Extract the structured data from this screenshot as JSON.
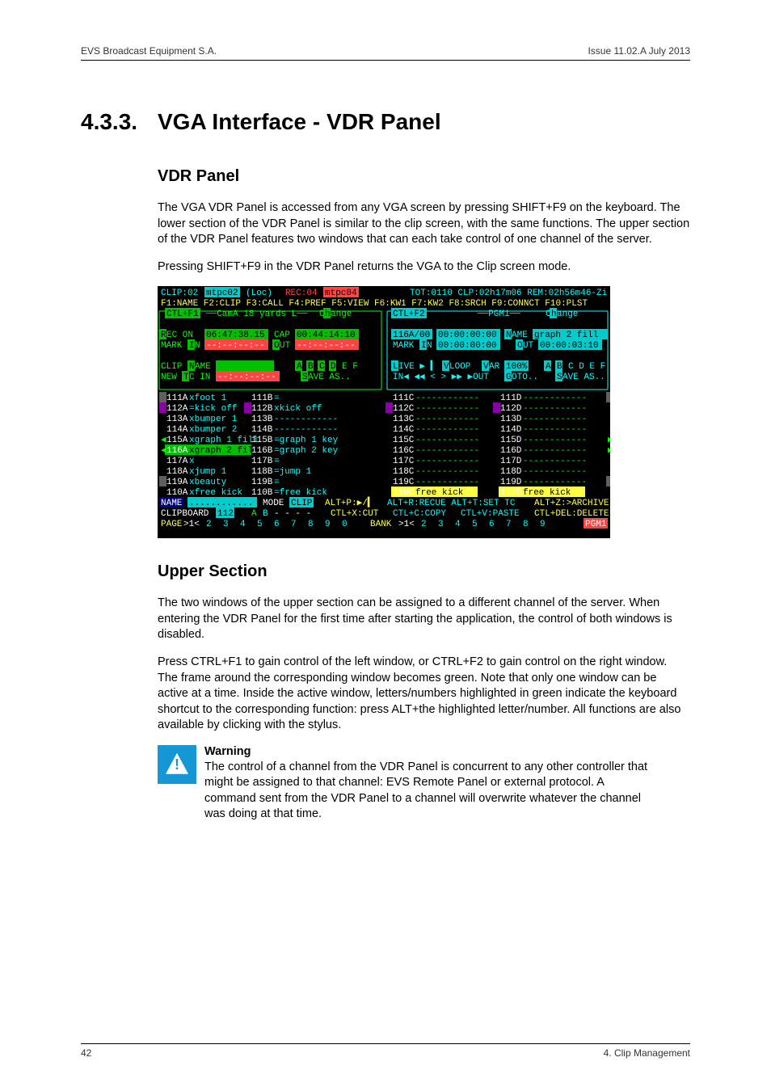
{
  "header": {
    "left": "EVS Broadcast Equipment S.A.",
    "right": "Issue 11.02.A  July 2013"
  },
  "section": {
    "number": "4.3.3.",
    "title": "VGA Interface - VDR Panel"
  },
  "vdr": {
    "heading": "VDR Panel",
    "p1_a": "The VGA VDR Panel is accessed from any VGA screen by pressing ",
    "p1_b": "SHIFT+F9",
    "p1_c": " on the keyboard. The lower section of the VDR Panel is similar to the clip screen, with the same functions. The upper section of the VDR Panel features two windows that can each take control of one channel of the server.",
    "p2_a": "Pressing ",
    "p2_b": "SHIFT+F9",
    "p2_c": " in the VDR Panel returns the VGA to the Clip screen mode."
  },
  "upper": {
    "heading": "Upper Section",
    "p1": "The two windows of the upper section can be assigned to a different channel of the server. When entering the VDR Panel for the first time after starting the application, the control of both windows is disabled.",
    "p2_a": "Press ",
    "p2_b": "CTRL+F1",
    "p2_c": " to gain control of the left window, or ",
    "p2_d": "CTRL+F2",
    "p2_e": " to gain control on the right window. The frame around the corresponding window becomes green. Note that only one window can be active at a time. Inside the active window, letters/numbers highlighted in green indicate the keyboard shortcut to the corresponding function: press ",
    "p2_f": "ALT+",
    "p2_g": "the highlighted letter/number. All functions are also available by clicking with the stylus."
  },
  "warn": {
    "title": "Warning",
    "body": "The control of a channel from the VDR Panel is concurrent to any other controller that might be assigned to that channel: EVS Remote Panel or external protocol. A command sent from the VDR Panel to a channel will overwrite whatever the channel was doing at that time."
  },
  "footer": {
    "left": "42",
    "right": "4. Clip Management"
  },
  "chart_data": {
    "type": "table",
    "title": "VGA VDR Panel screenshot (text-mode terminal UI)",
    "header_line": "CLIP:02 mtpc02  (Loc) REC:04 mtpc04        TOT:0110 CLP:02h17m06 REM:02h56m46-Zi",
    "fkeys": "F1:NAME F2:CLIP F3:CALL F4:PREF F5:VIEW F6:KW1 F7:KW2 F8:SRCH F9:CONNCT F10:PLST",
    "left_window": {
      "frame": "CTL+F1",
      "title": "CamA 18 yards L",
      "change": "Change",
      "rec": {
        "label": "REC ON",
        "tc": "06:47:38.15",
        "cap": "CAP",
        "cap_tc": "00:44:14:10"
      },
      "mark": {
        "in_label": "MARK IN",
        "in_tc": "--:--:--:--",
        "out_label": "OUT",
        "out_tc": "--:--:--:--"
      },
      "clip_name": {
        "label": "CLIP NAME",
        "value": "",
        "cams": "A B C D E F"
      },
      "new_tc": {
        "label": "NEW TC IN",
        "value": "--:--:--:--",
        "save": "SAVE AS.."
      }
    },
    "right_window": {
      "frame": "CTL+F2",
      "title": "PGM1",
      "change": "Change",
      "rec": {
        "id": "116A/00",
        "tc": "00:00:00:00",
        "name_label": "NAME",
        "name": "graph 2 fill"
      },
      "mark": {
        "in_label": "MARK IN",
        "in_tc": "00:00:00:00",
        "out_label": "OUT",
        "out_tc": "00:00:03:10"
      },
      "live": {
        "label": "LIVE ▶ ▍ VLOOP",
        "var": "VAR 100%",
        "cams": "A B C D E F"
      },
      "transport": {
        "label": "IN◀ ◀◀ <  > ▶▶ ▶OUT GOTO..",
        "save": "SAVE AS.."
      }
    },
    "clip_grid": {
      "columns": [
        "A",
        "B",
        "C",
        "D"
      ],
      "rows": [
        {
          "A": {
            "id": "111A",
            "name": "xfoot 1"
          },
          "B": {
            "id": "111B",
            "name": "="
          },
          "C": {
            "id": "111C",
            "name": "------------"
          },
          "D": {
            "id": "111D",
            "name": "------------"
          }
        },
        {
          "A": {
            "id": "112A",
            "name": "=kick off",
            "aux": true
          },
          "B": {
            "id": "112B",
            "name": "xkick off",
            "aux": true
          },
          "C": {
            "id": "112C",
            "name": "------------",
            "aux": true
          },
          "D": {
            "id": "112D",
            "name": "------------",
            "aux": true
          }
        },
        {
          "A": {
            "id": "113A",
            "name": "xbumper 1"
          },
          "B": {
            "id": "113B",
            "name": "------------"
          },
          "C": {
            "id": "113C",
            "name": "------------"
          },
          "D": {
            "id": "113D",
            "name": "------------"
          }
        },
        {
          "A": {
            "id": "114A",
            "name": "xbumper 2"
          },
          "B": {
            "id": "114B",
            "name": "------------"
          },
          "C": {
            "id": "114C",
            "name": "------------"
          },
          "D": {
            "id": "114D",
            "name": "------------"
          }
        },
        {
          "A": {
            "id": "115A",
            "name": "xgraph 1 fill"
          },
          "B": {
            "id": "115B",
            "name": "=graph 1 key"
          },
          "C": {
            "id": "115C",
            "name": "------------"
          },
          "D": {
            "id": "115D",
            "name": "------------"
          }
        },
        {
          "A": {
            "id": "116A",
            "name": "xgraph 2 fill",
            "sel": true
          },
          "B": {
            "id": "116B",
            "name": "=graph 2 key"
          },
          "C": {
            "id": "116C",
            "name": "------------"
          },
          "D": {
            "id": "116D",
            "name": "------------"
          }
        },
        {
          "A": {
            "id": "117A",
            "name": "x"
          },
          "B": {
            "id": "117B",
            "name": "="
          },
          "C": {
            "id": "117C",
            "name": "------------"
          },
          "D": {
            "id": "117D",
            "name": "------------"
          }
        },
        {
          "A": {
            "id": "118A",
            "name": "xjump 1"
          },
          "B": {
            "id": "118B",
            "name": "=jump 1"
          },
          "C": {
            "id": "118C",
            "name": "------------"
          },
          "D": {
            "id": "118D",
            "name": "------------"
          }
        },
        {
          "A": {
            "id": "119A",
            "name": "xbeauty"
          },
          "B": {
            "id": "119B",
            "name": "="
          },
          "C": {
            "id": "119C",
            "name": "------------"
          },
          "D": {
            "id": "119D",
            "name": "------------"
          }
        },
        {
          "A": {
            "id": "110A",
            "name": "xfree kick"
          },
          "B": {
            "id": "110B",
            "name": "=free kick"
          },
          "C": {
            "id": "110C",
            "name": " free kick",
            "hl": true
          },
          "D": {
            "id": "110D",
            "name": " free kick",
            "hl": true
          }
        }
      ]
    },
    "status1": "NAME ............ MODE CLIP  ALT+P:▶/▍ ALT+R:RECUE ALT+T:SET TC ALT+Z:>ARCHIVE",
    "status2": "CLIPBOARD 112    A B - - - -  CTL+X:CUT  CTL+C:COPY  CTL+V:PASTE  CTL+DEL:DELETE",
    "status3": "PAGE>1< 2  3  4  5  6  7  8  9  0    BANK >1< 2  3  4  5  6  7  8  9        PGM1"
  }
}
